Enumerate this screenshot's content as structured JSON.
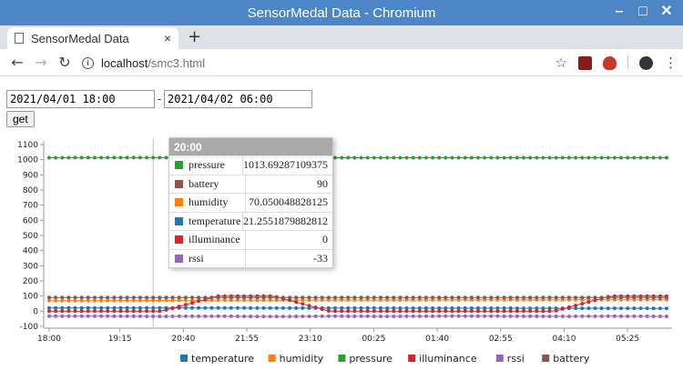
{
  "window": {
    "title": "SensorMedal Data - Chromium"
  },
  "tab": {
    "title": "SensorMedal Data",
    "close": "×",
    "new_tab": "+"
  },
  "toolbar": {
    "url_host": "localhost",
    "url_path": "/smc3.html"
  },
  "form": {
    "start": "2021/04/01 18:00",
    "dash": "-",
    "end": "2021/04/02 06:00",
    "get_label": "get"
  },
  "tooltip": {
    "title": "20:00",
    "rows": [
      {
        "name": "pressure",
        "value": "1013.69287109375",
        "color": "#2ca02c"
      },
      {
        "name": "battery",
        "value": "90",
        "color": "#8c564b"
      },
      {
        "name": "humidity",
        "value": "70.050048828125",
        "color": "#ff7f0e"
      },
      {
        "name": "temperature",
        "value": "21.2551879882812",
        "color": "#1f77b4"
      },
      {
        "name": "illuminance",
        "value": "0",
        "color": "#d62728"
      },
      {
        "name": "rssi",
        "value": "-33",
        "color": "#9467bd"
      }
    ]
  },
  "chart_data": {
    "type": "line",
    "x_ticks": [
      "18:00",
      "19:15",
      "20:40",
      "21:55",
      "23:10",
      "00:25",
      "01:40",
      "02:55",
      "04:10",
      "05:25"
    ],
    "y_ticks": [
      -100,
      0,
      100,
      200,
      300,
      400,
      500,
      600,
      700,
      800,
      900,
      1000,
      1100
    ],
    "ylim": [
      -100,
      1100
    ],
    "legend_position": "bottom",
    "series": [
      {
        "name": "temperature",
        "color": "#1f77b4",
        "values": [
          21,
          21.3,
          21.2,
          21,
          20.8,
          20.5,
          20.3,
          20,
          19.8,
          19.5,
          19.3,
          19
        ]
      },
      {
        "name": "humidity",
        "color": "#ff7f0e",
        "values": [
          70,
          70.1,
          71,
          72,
          73,
          74,
          74,
          75,
          75,
          76,
          76,
          77
        ]
      },
      {
        "name": "pressure",
        "color": "#2ca02c",
        "values": [
          1013,
          1013.7,
          1013.6,
          1013.5,
          1013.4,
          1013.3,
          1013.3,
          1013.2,
          1013.2,
          1013.1,
          1013.1,
          1013
        ]
      },
      {
        "name": "illuminance",
        "color": "#d62728",
        "values": [
          0,
          0,
          0,
          100,
          100,
          0,
          0,
          0,
          0,
          0,
          100,
          100
        ]
      },
      {
        "name": "rssi",
        "color": "#9467bd",
        "values": [
          -33,
          -33,
          -34,
          -33,
          -35,
          -33,
          -34,
          -33,
          -33,
          -34,
          -33,
          -34
        ]
      },
      {
        "name": "battery",
        "color": "#8c564b",
        "values": [
          90,
          90,
          90,
          90,
          90,
          90,
          90,
          90,
          90,
          90,
          90,
          90
        ]
      }
    ]
  }
}
